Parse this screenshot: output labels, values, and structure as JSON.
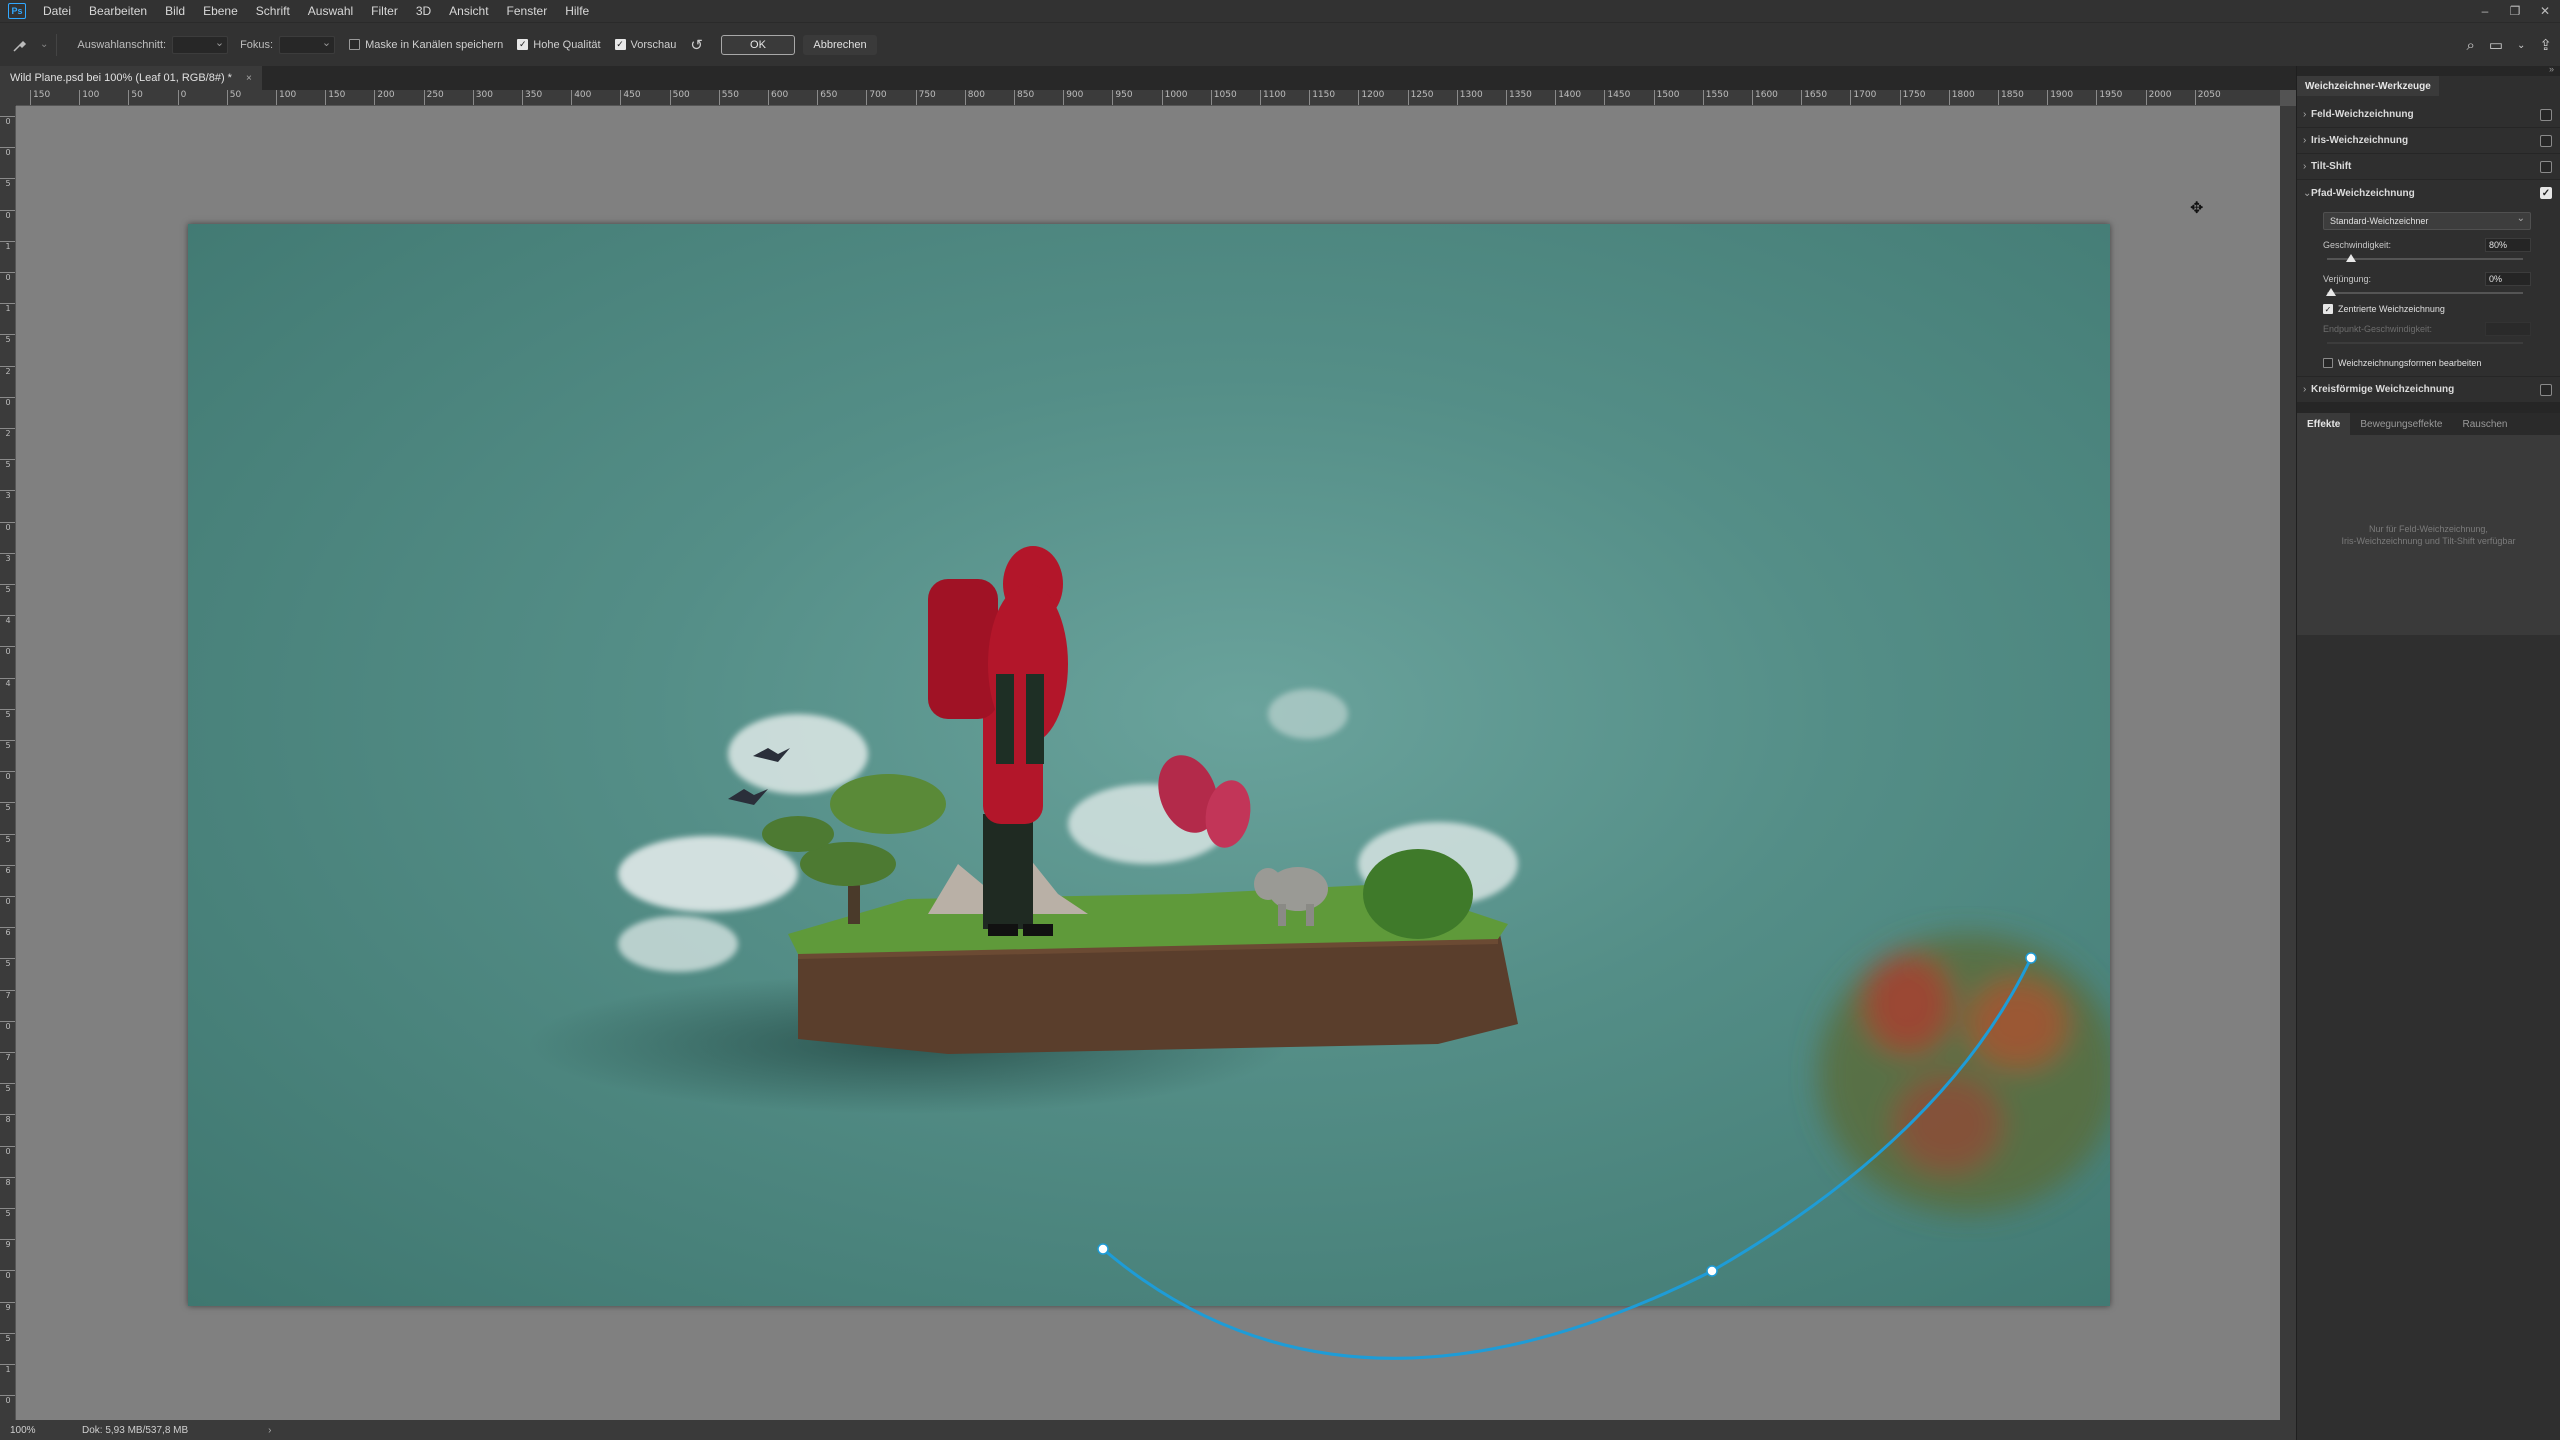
{
  "app": {
    "logo_text": "Ps",
    "name": "Photoshop"
  },
  "menubar": {
    "items": [
      "Datei",
      "Bearbeiten",
      "Bild",
      "Ebene",
      "Schrift",
      "Auswahl",
      "Filter",
      "3D",
      "Ansicht",
      "Fenster",
      "Hilfe"
    ]
  },
  "window_controls": {
    "minimize": "–",
    "restore": "❐",
    "close": "✕"
  },
  "options": {
    "selection_label": "Auswahlanschnitt:",
    "focus_label": "Fokus:",
    "mask_label": "Maske in Kanälen speichern",
    "mask_checked": false,
    "quality_label": "Hohe Qualität",
    "quality_checked": true,
    "preview_label": "Vorschau",
    "preview_checked": true,
    "ok_label": "OK",
    "cancel_label": "Abbrechen"
  },
  "document": {
    "tab_title": "Wild Plane.psd bei 100% (Leaf 01, RGB/8#) *",
    "close": "×"
  },
  "ruler": {
    "h_labels": [
      "150",
      "100",
      "50",
      "0",
      "50",
      "100",
      "150",
      "200",
      "250",
      "300",
      "350",
      "400",
      "450",
      "500",
      "550",
      "600",
      "650",
      "700",
      "750",
      "800",
      "850",
      "900",
      "950",
      "1000",
      "1050",
      "1100",
      "1150",
      "1200",
      "1250",
      "1300",
      "1350",
      "1400",
      "1450",
      "1500",
      "1550",
      "1600",
      "1650",
      "1700",
      "1750",
      "1800",
      "1850",
      "1900",
      "1950",
      "2000",
      "2050"
    ],
    "v_labels": [
      "0",
      "0",
      "5",
      "0",
      "1",
      "0",
      "1",
      "5",
      "2",
      "0",
      "2",
      "5",
      "3",
      "0",
      "3",
      "5",
      "4",
      "0",
      "4",
      "5",
      "5",
      "0",
      "5",
      "5",
      "6",
      "0",
      "6",
      "5",
      "7",
      "0",
      "7",
      "5",
      "8",
      "0",
      "8",
      "5",
      "9",
      "0",
      "9",
      "5",
      "1",
      "0"
    ]
  },
  "status": {
    "zoom": "100%",
    "doc_size": "Dok: 5,93 MB/537,8 MB",
    "arrow": "›"
  },
  "panel": {
    "title": "Weichzeichner-Werkzeuge",
    "sections": [
      {
        "label": "Feld-Weichzeichnung",
        "checked": false
      },
      {
        "label": "Iris-Weichzeichnung",
        "checked": false
      },
      {
        "label": "Tilt-Shift",
        "checked": false
      },
      {
        "label": "Pfad-Weichzeichnung",
        "checked": true
      }
    ],
    "path": {
      "preset": "Standard-Weichzeichner",
      "speed_label": "Geschwindigkeit:",
      "speed_value": "80%",
      "speed_fraction": 0.1,
      "taper_label": "Verjüngung:",
      "taper_value": "0%",
      "taper_fraction": 0.0,
      "centered_label": "Zentrierte Weichzeichnung",
      "centered_checked": true,
      "endpoint_label": "Endpunkt-Geschwindigkeit:",
      "edit_shapes_label": "Weichzeichnungsformen bearbeiten",
      "edit_shapes_checked": false
    },
    "radial": {
      "label": "Kreisförmige Weichzeichnung",
      "checked": false
    },
    "effects_tabs": [
      "Effekte",
      "Bewegungseffekte",
      "Rauschen"
    ],
    "effects_note_line1": "Nur für Feld-Weichzeichnung,",
    "effects_note_line2": "Iris-Weichzeichnung und Tilt-Shift verfügbar",
    "expand_icon": "»"
  },
  "colors": {
    "blur_path": "#1e9cd7",
    "canvas_bg": "#808080",
    "image_bg": "#548e87",
    "accent": "#31a8ff"
  }
}
